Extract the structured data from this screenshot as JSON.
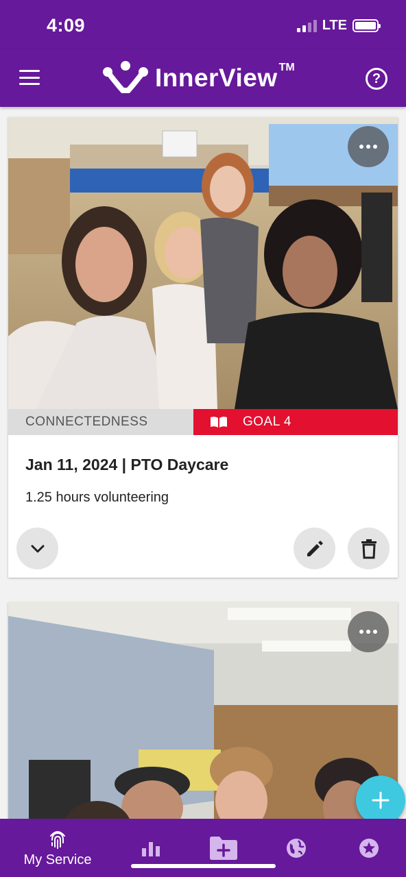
{
  "status_bar": {
    "time": "4:09",
    "network": "LTE"
  },
  "header": {
    "brand": "InnerView",
    "trademark": "TM"
  },
  "cards": [
    {
      "category": "CONNECTEDNESS",
      "goal": "GOAL 4",
      "title": "Jan 11, 2024 | PTO Daycare",
      "subtitle": "1.25 hours volunteering"
    },
    {}
  ],
  "bottom_nav": {
    "items": [
      {
        "label": "My Service",
        "icon": "fingerprint-icon"
      },
      {
        "icon": "bar-chart-icon"
      },
      {
        "icon": "add-folder-icon"
      },
      {
        "icon": "globe-icon"
      },
      {
        "icon": "star-icon"
      }
    ]
  },
  "colors": {
    "brand_purple": "#66199a",
    "goal_red": "#e3102f",
    "fab_cyan": "#3ec9e0"
  }
}
